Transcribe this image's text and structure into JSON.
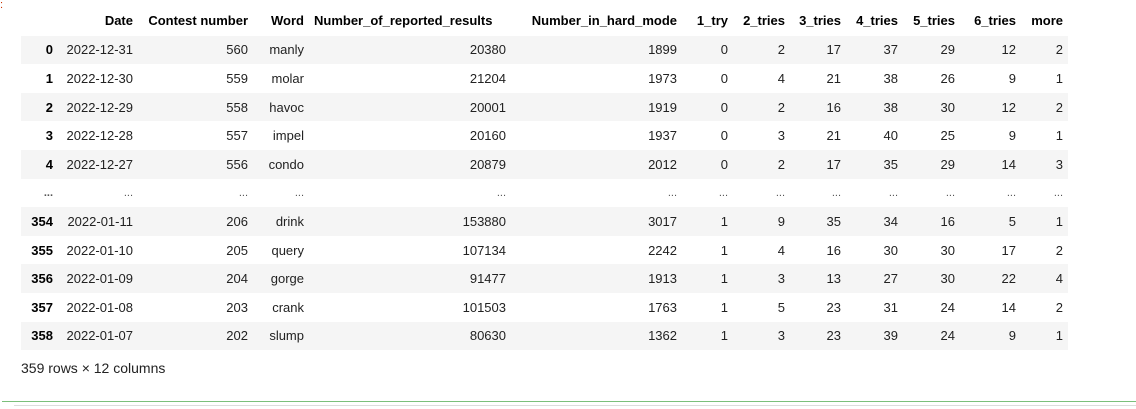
{
  "table": {
    "columns": [
      "",
      "Date",
      "Contest number",
      "Word",
      "Number_of_reported_results",
      "Number_in_hard_mode",
      "1_try",
      "2_tries",
      "3_tries",
      "4_tries",
      "5_tries",
      "6_tries",
      "more"
    ],
    "rows": [
      [
        "0",
        "2022-12-31",
        "560",
        "manly",
        "20380",
        "1899",
        "0",
        "2",
        "17",
        "37",
        "29",
        "12",
        "2"
      ],
      [
        "1",
        "2022-12-30",
        "559",
        "molar",
        "21204",
        "1973",
        "0",
        "4",
        "21",
        "38",
        "26",
        "9",
        "1"
      ],
      [
        "2",
        "2022-12-29",
        "558",
        "havoc",
        "20001",
        "1919",
        "0",
        "2",
        "16",
        "38",
        "30",
        "12",
        "2"
      ],
      [
        "3",
        "2022-12-28",
        "557",
        "impel",
        "20160",
        "1937",
        "0",
        "3",
        "21",
        "40",
        "25",
        "9",
        "1"
      ],
      [
        "4",
        "2022-12-27",
        "556",
        "condo",
        "20879",
        "2012",
        "0",
        "2",
        "17",
        "35",
        "29",
        "14",
        "3"
      ],
      [
        "...",
        "...",
        "...",
        "...",
        "...",
        "...",
        "...",
        "...",
        "...",
        "...",
        "...",
        "...",
        "..."
      ],
      [
        "354",
        "2022-01-11",
        "206",
        "drink",
        "153880",
        "3017",
        "1",
        "9",
        "35",
        "34",
        "16",
        "5",
        "1"
      ],
      [
        "355",
        "2022-01-10",
        "205",
        "query",
        "107134",
        "2242",
        "1",
        "4",
        "16",
        "30",
        "30",
        "17",
        "2"
      ],
      [
        "356",
        "2022-01-09",
        "204",
        "gorge",
        "91477",
        "1913",
        "1",
        "3",
        "13",
        "27",
        "30",
        "22",
        "4"
      ],
      [
        "357",
        "2022-01-08",
        "203",
        "crank",
        "101503",
        "1763",
        "1",
        "5",
        "23",
        "31",
        "24",
        "14",
        "2"
      ],
      [
        "358",
        "2022-01-07",
        "202",
        "slump",
        "80630",
        "1362",
        "1",
        "3",
        "23",
        "39",
        "24",
        "9",
        "1"
      ]
    ]
  },
  "shape_text": "359 rows × 12 columns",
  "prompt_marker": ":"
}
